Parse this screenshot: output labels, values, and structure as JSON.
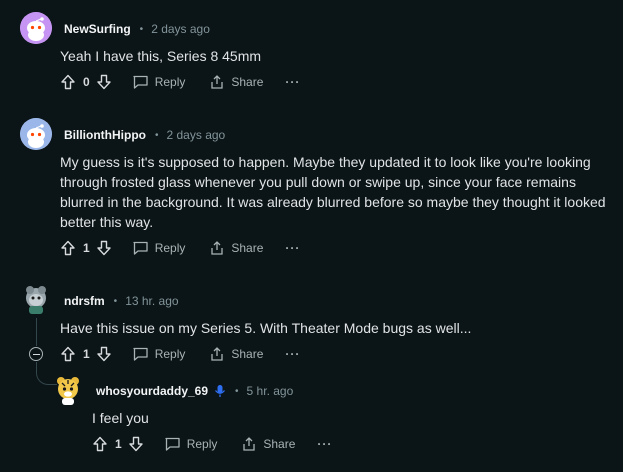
{
  "comments": [
    {
      "author": "NewSurfing",
      "time": "2 days ago",
      "body": "Yeah I have this, Series 8 45mm",
      "votes": "0",
      "reply_label": "Reply",
      "share_label": "Share",
      "more_label": "···",
      "avatar_color": "#c694f2"
    },
    {
      "author": "BillionthHippo",
      "time": "2 days ago",
      "body": "My guess is it's supposed to happen. Maybe they updated it to look like you're looking through frosted glass whenever you pull down or swipe up, since your face remains blurred in the background. It was already blurred before so maybe they thought it looked better this way.",
      "votes": "1",
      "reply_label": "Reply",
      "share_label": "Share",
      "more_label": "···",
      "avatar_color": "#9bb7ea"
    },
    {
      "author": "ndrsfm",
      "time": "13 hr. ago",
      "body": "Have this issue on my Series 5. With Theater Mode bugs as well...",
      "votes": "1",
      "reply_label": "Reply",
      "share_label": "Share",
      "more_label": "···"
    },
    {
      "author": "whosyourdaddy_69",
      "time": "5 hr. ago",
      "body": "I feel you",
      "votes": "1",
      "reply_label": "Reply",
      "share_label": "Share",
      "more_label": "···",
      "badge_color": "#2e6ef0"
    }
  ],
  "colors": {
    "background": "#0b1416",
    "meta": "#82959b",
    "thread_line": "#33464c"
  }
}
